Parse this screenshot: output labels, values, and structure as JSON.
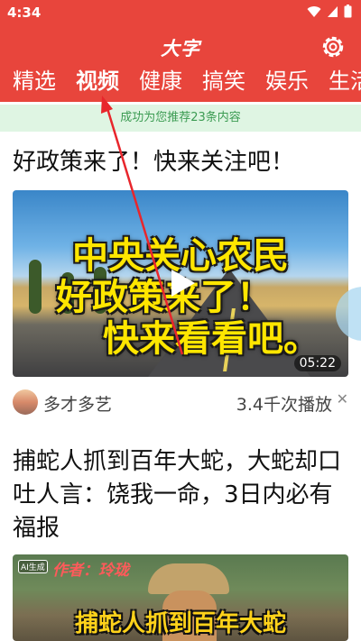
{
  "status_bar": {
    "time": "4:34"
  },
  "header": {
    "app_title": "大字",
    "tabs": [
      {
        "label": "精选",
        "active": false
      },
      {
        "label": "视频",
        "active": true
      },
      {
        "label": "健康",
        "active": false
      },
      {
        "label": "搞笑",
        "active": false
      },
      {
        "label": "娱乐",
        "active": false
      },
      {
        "label": "生活",
        "active": false
      }
    ]
  },
  "toast": {
    "text": "成功为您推荐23条内容"
  },
  "feed": [
    {
      "title": "好政策来了！快来关注吧！",
      "cover_lines": [
        "中央关心农民",
        "好政策来了！",
        "快来看看吧。"
      ],
      "duration": "05:22",
      "author": "多才多艺",
      "plays": "3.4千次播放"
    },
    {
      "title": "捕蛇人抓到百年大蛇，大蛇却口吐人言：饶我一命，3日内必有福报",
      "ai_badge": "AI生成",
      "author_tag": "作者：玲珑",
      "cover_line": "捕蛇人抓到百年大蛇"
    }
  ],
  "colors": {
    "header_bg": "#e8453c",
    "toast_bg": "#dff5e3",
    "toast_text": "#3b9b52",
    "cover_text": "#ffe600",
    "annotation_arrow": "#e8262c"
  },
  "icons": {
    "wifi": "wifi-icon",
    "signal": "signal-icon",
    "battery": "battery-icon",
    "settings": "gear-icon",
    "play": "play-icon",
    "close": "close-icon"
  }
}
